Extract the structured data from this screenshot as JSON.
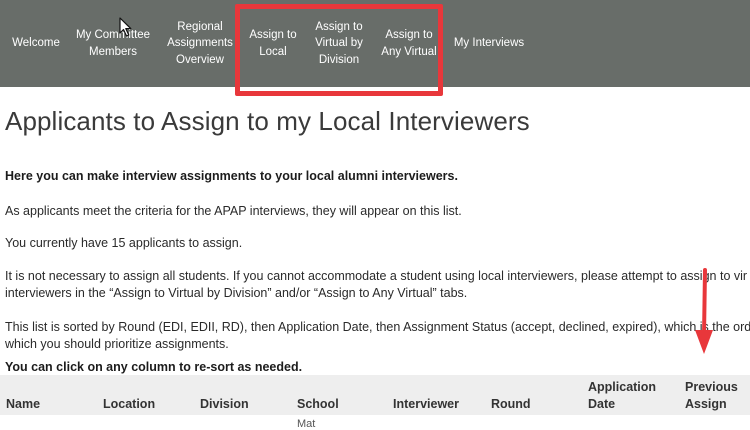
{
  "nav": {
    "items": [
      {
        "label": "Welcome"
      },
      {
        "label": "My Committee\nMembers"
      },
      {
        "label": "Regional\nAssignments\nOverview"
      },
      {
        "label": "Assign to\nLocal"
      },
      {
        "label": "Assign to\nVirtual by\nDivision"
      },
      {
        "label": "Assign to\nAny Virtual"
      },
      {
        "label": "My Interviews"
      }
    ]
  },
  "page": {
    "title": "Applicants to Assign to my Local Interviewers",
    "intro_bold": "Here you can make interview assignments to your local alumni interviewers.",
    "p1": "As applicants meet the criteria for the APAP interviews, they will appear on this list.",
    "p2": "You currently have 15 applicants to assign.",
    "p3_line1": "It is not necessary to assign all students. If you cannot accommodate a student using local interviewers, please attempt to assign to vir",
    "p3_line2": "interviewers in the “Assign to Virtual by Division” and/or “Assign to Any Virtual” tabs.",
    "p4_line1": "This list is sorted by Round (EDI, EDII, RD), then Application Date, then Assignment Status (accept, declined, expired), which is the orde",
    "p4_line2": "which you should prioritize assignments.",
    "resort_bold": "You can click on any column to re-sort as needed."
  },
  "table": {
    "columns": [
      "Name",
      "Location",
      "Division",
      "School",
      "Interviewer",
      "Round",
      "Application\nDate",
      "Previous\nAssign"
    ],
    "first_row_partial": "Mat"
  },
  "annotations": {
    "highlight_color": "#e8373b",
    "cursor_icon": "mouse-pointer-icon",
    "arrow_icon": "red-down-arrow-icon"
  }
}
